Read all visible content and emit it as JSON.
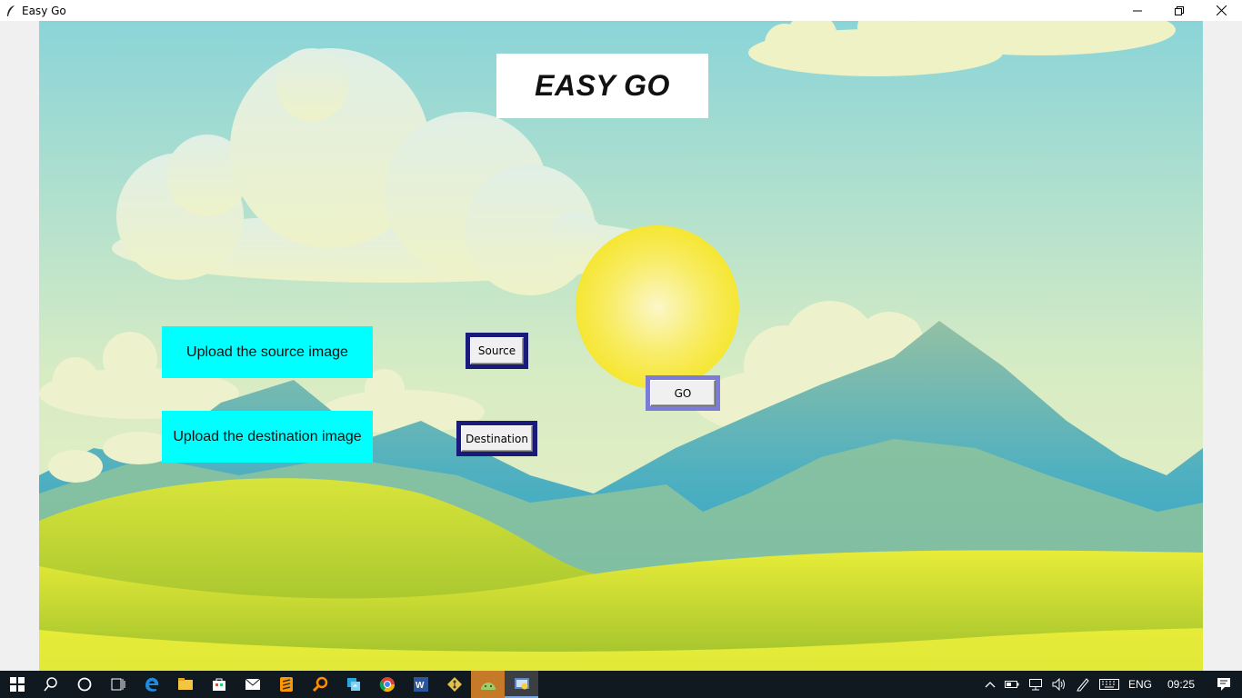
{
  "window": {
    "title": "Easy Go",
    "controls": [
      "minimize",
      "restore",
      "close"
    ]
  },
  "app": {
    "heading": "EASY GO",
    "source_label": "Upload the source image",
    "destination_label": "Upload the destination image",
    "source_button": "Source",
    "destination_button": "Destination",
    "go_button": "GO",
    "colors": {
      "label_bg": "#00ffff",
      "frame_dark": "#1a1a7a",
      "frame_go": "#7b7bd8",
      "sky_top": "#8ad4d8",
      "sun": "#f6e93a"
    }
  },
  "taskbar": {
    "apps": [
      "start-icon",
      "search-icon",
      "cortana-icon",
      "task-view-icon",
      "edge-icon",
      "file-explorer-icon",
      "store-icon",
      "mail-icon",
      "sublime-icon",
      "search-app-icon",
      "sync-icon",
      "chrome-icon",
      "word-icon",
      "git-icon",
      "android-studio-icon",
      "python-app-icon"
    ],
    "tray": {
      "language": "ENG",
      "time": "09:25"
    }
  }
}
